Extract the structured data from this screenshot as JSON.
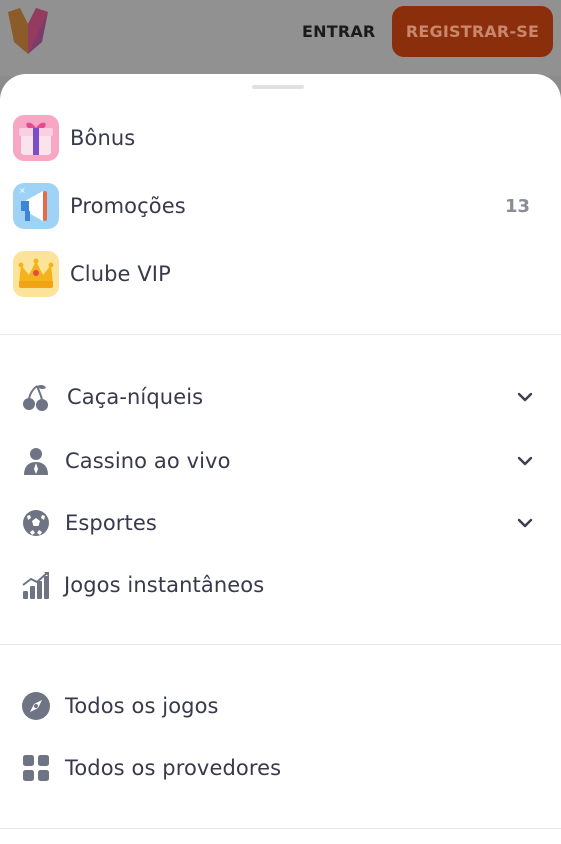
{
  "header": {
    "login_label": "ENTRAR",
    "register_label": "REGISTRAR-SE"
  },
  "rewards": [
    {
      "icon": "gift-icon",
      "label": "Bônus"
    },
    {
      "icon": "megaphone-icon",
      "label": "Promoções",
      "count": "13"
    },
    {
      "icon": "crown-icon",
      "label": "Clube VIP"
    }
  ],
  "categories": [
    {
      "icon": "cherries-icon",
      "label": "Caça-níqueis",
      "expandable": true
    },
    {
      "icon": "dealer-icon",
      "label": "Cassino ao vivo",
      "expandable": true
    },
    {
      "icon": "soccer-ball-icon",
      "label": "Esportes",
      "expandable": true
    },
    {
      "icon": "bar-chart-icon",
      "label": "Jogos instantâneos",
      "expandable": false
    }
  ],
  "all": [
    {
      "icon": "compass-icon",
      "label": "Todos os jogos"
    },
    {
      "icon": "grid-icon",
      "label": "Todos os provedores"
    }
  ],
  "colors": {
    "text": "#363a4a",
    "icon_gray": "#7a7f8f",
    "register_bg": "#8a2e0c",
    "count": "#8a8d98"
  }
}
